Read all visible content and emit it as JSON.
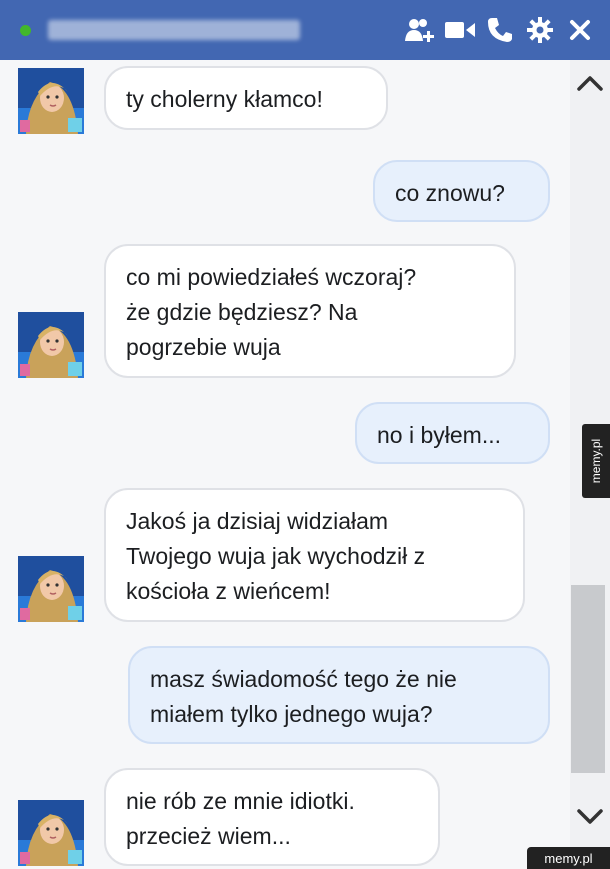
{
  "header": {
    "status_color": "#42b72a",
    "icons": [
      "add-people-icon",
      "video-call-icon",
      "phone-icon",
      "gear-icon",
      "close-icon"
    ]
  },
  "messages": [
    {
      "side": "received",
      "text": "ty cholerny kłamco!"
    },
    {
      "side": "sent",
      "text": "co znowu?"
    },
    {
      "side": "received",
      "lines": [
        "co mi powiedziałeś wczoraj?",
        "że gdzie będziesz? Na",
        "pogrzebie wuja"
      ]
    },
    {
      "side": "sent",
      "text": "no i byłem..."
    },
    {
      "side": "received",
      "lines": [
        "Jakoś ja dzisiaj widziałam",
        "Twojego wuja jak wychodził z",
        "kościoła z wieńcem!"
      ]
    },
    {
      "side": "sent",
      "lines": [
        "masz świadomość tego że nie",
        "miałem tylko jednego wuja?"
      ]
    },
    {
      "side": "received",
      "lines": [
        "nie rób ze mnie idiotki.",
        "przecież wiem..."
      ]
    }
  ],
  "watermarks": {
    "side": "memy.pl",
    "bottom": "memy.pl"
  },
  "colors": {
    "header": "#4267b2",
    "sent_bubble": "#e7f0fc",
    "received_bubble": "#ffffff"
  }
}
